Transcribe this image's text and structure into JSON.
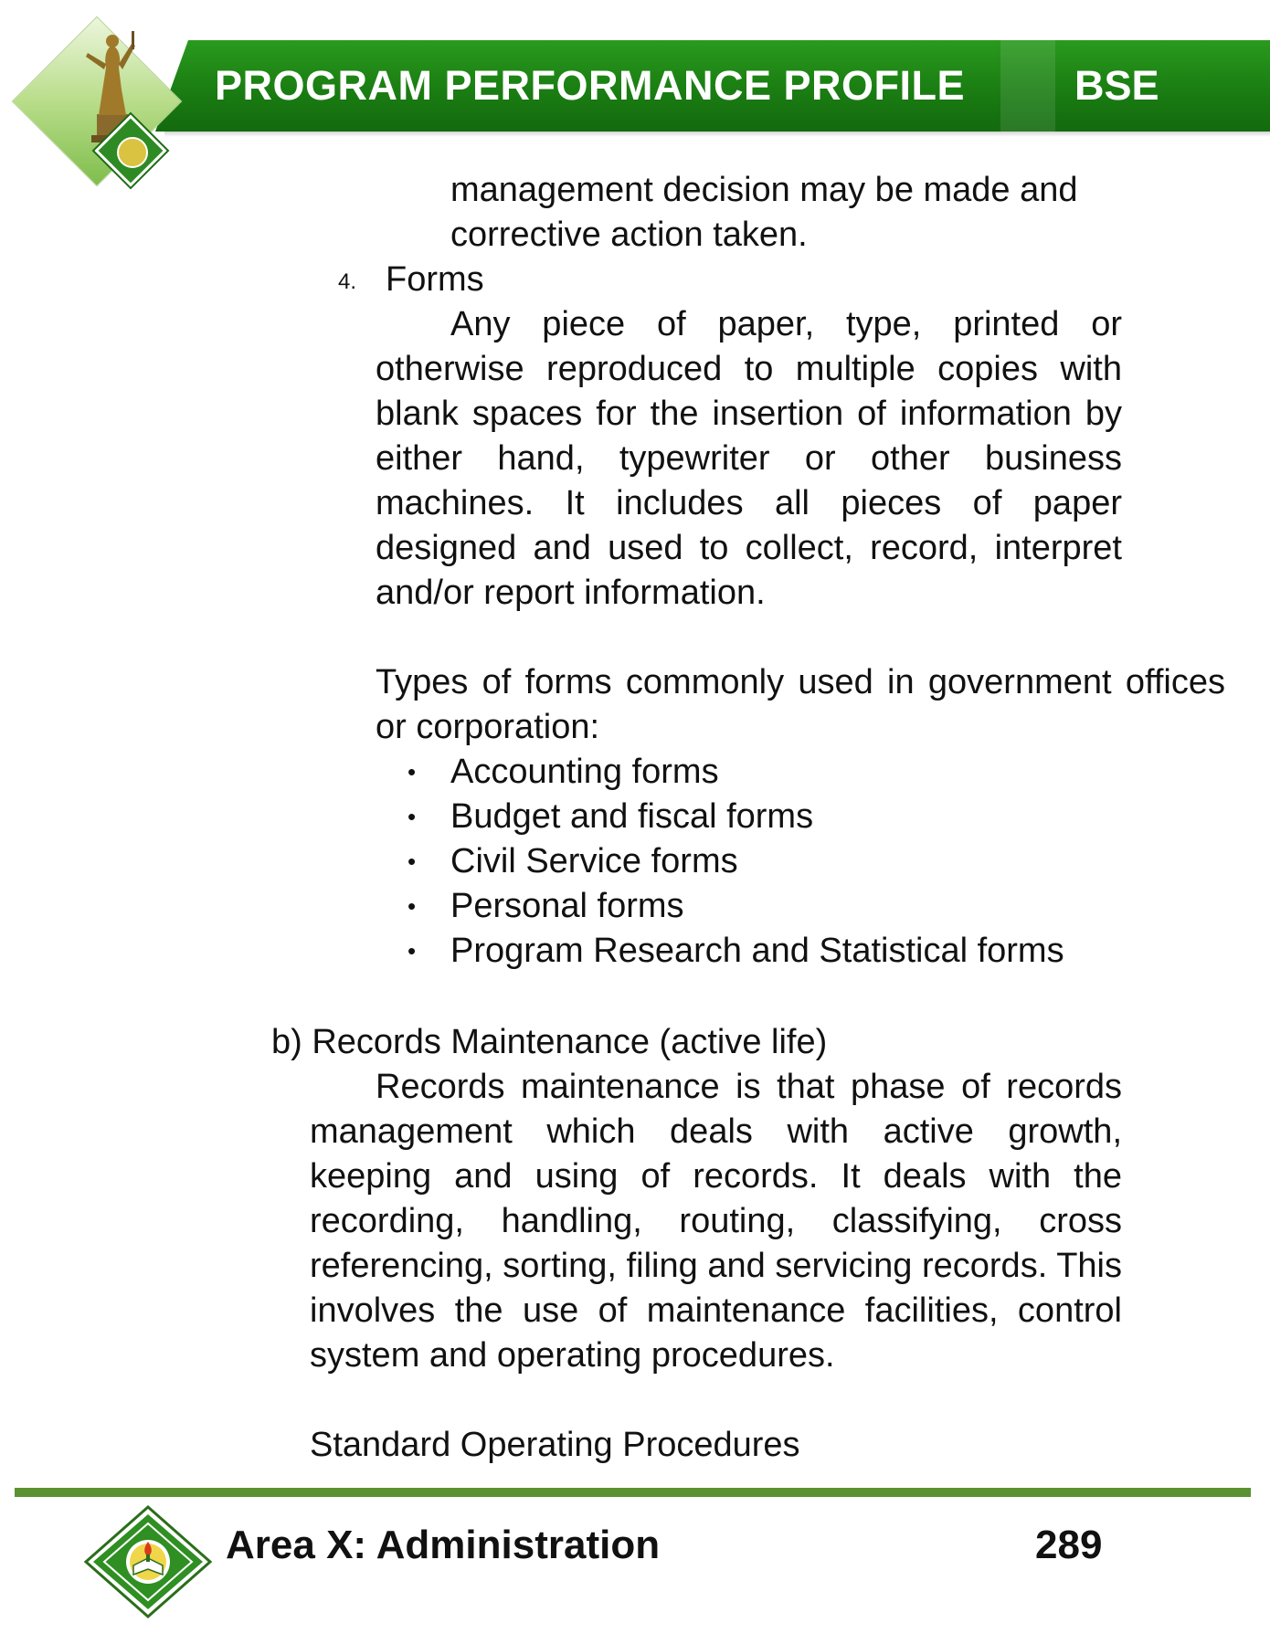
{
  "header": {
    "title": "PROGRAM PERFORMANCE PROFILE",
    "code": "BSE"
  },
  "content": {
    "continuation_lines": [
      "management decision may be made and",
      "corrective action taken."
    ],
    "forms_section": {
      "number": "4.",
      "heading": "Forms",
      "paragraph_first_line": "Any piece of paper, type, printed or",
      "paragraph_rest": "otherwise reproduced to multiple copies with blank spaces for the insertion of information by either hand, typewriter or other business machines.  It includes all pieces of paper designed and used to collect, record, interpret and/or report information.",
      "types_intro": "Types of forms commonly used in government offices or corporation:",
      "types": [
        "Accounting forms",
        "Budget and fiscal forms",
        "Civil Service forms",
        "Personal forms",
        "Program Research and Statistical forms"
      ]
    },
    "records_maintenance": {
      "heading": "b) Records Maintenance (active life)",
      "paragraph_first_line": "Records maintenance is that phase of records",
      "paragraph_rest": "management which deals with active growth, keeping and using of records.  It deals with the recording, handling, routing, classifying, cross referencing, sorting, filing and servicing records. This involves the use of maintenance facilities, control system and operating procedures.",
      "sop_heading": "Standard Operating Procedures"
    }
  },
  "footer": {
    "title": "Area X: Administration",
    "page_number": "289"
  }
}
